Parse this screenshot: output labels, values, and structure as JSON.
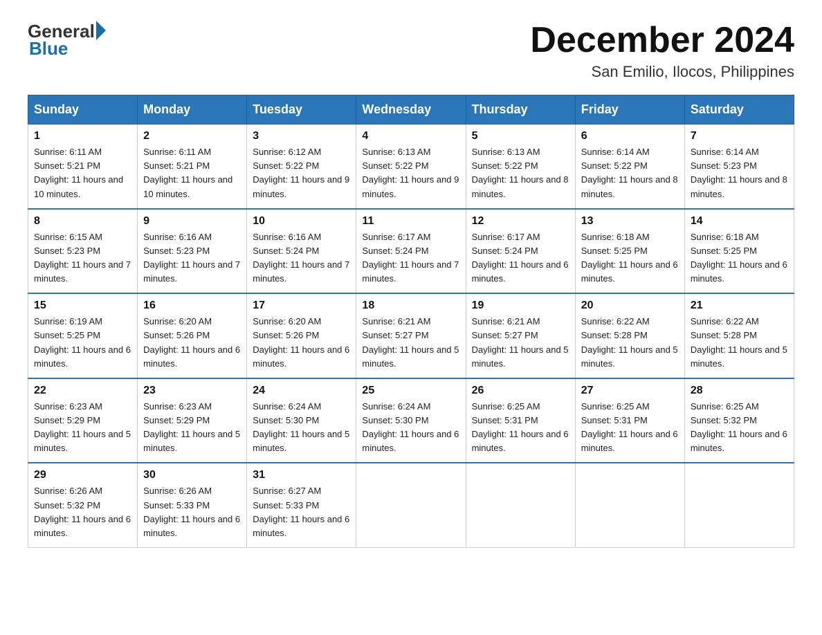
{
  "header": {
    "logo_general": "General",
    "logo_blue": "Blue",
    "month_title": "December 2024",
    "location": "San Emilio, Ilocos, Philippines"
  },
  "days_of_week": [
    "Sunday",
    "Monday",
    "Tuesday",
    "Wednesday",
    "Thursday",
    "Friday",
    "Saturday"
  ],
  "weeks": [
    [
      {
        "day": "1",
        "sunrise": "6:11 AM",
        "sunset": "5:21 PM",
        "daylight": "11 hours and 10 minutes."
      },
      {
        "day": "2",
        "sunrise": "6:11 AM",
        "sunset": "5:21 PM",
        "daylight": "11 hours and 10 minutes."
      },
      {
        "day": "3",
        "sunrise": "6:12 AM",
        "sunset": "5:22 PM",
        "daylight": "11 hours and 9 minutes."
      },
      {
        "day": "4",
        "sunrise": "6:13 AM",
        "sunset": "5:22 PM",
        "daylight": "11 hours and 9 minutes."
      },
      {
        "day": "5",
        "sunrise": "6:13 AM",
        "sunset": "5:22 PM",
        "daylight": "11 hours and 8 minutes."
      },
      {
        "day": "6",
        "sunrise": "6:14 AM",
        "sunset": "5:22 PM",
        "daylight": "11 hours and 8 minutes."
      },
      {
        "day": "7",
        "sunrise": "6:14 AM",
        "sunset": "5:23 PM",
        "daylight": "11 hours and 8 minutes."
      }
    ],
    [
      {
        "day": "8",
        "sunrise": "6:15 AM",
        "sunset": "5:23 PM",
        "daylight": "11 hours and 7 minutes."
      },
      {
        "day": "9",
        "sunrise": "6:16 AM",
        "sunset": "5:23 PM",
        "daylight": "11 hours and 7 minutes."
      },
      {
        "day": "10",
        "sunrise": "6:16 AM",
        "sunset": "5:24 PM",
        "daylight": "11 hours and 7 minutes."
      },
      {
        "day": "11",
        "sunrise": "6:17 AM",
        "sunset": "5:24 PM",
        "daylight": "11 hours and 7 minutes."
      },
      {
        "day": "12",
        "sunrise": "6:17 AM",
        "sunset": "5:24 PM",
        "daylight": "11 hours and 6 minutes."
      },
      {
        "day": "13",
        "sunrise": "6:18 AM",
        "sunset": "5:25 PM",
        "daylight": "11 hours and 6 minutes."
      },
      {
        "day": "14",
        "sunrise": "6:18 AM",
        "sunset": "5:25 PM",
        "daylight": "11 hours and 6 minutes."
      }
    ],
    [
      {
        "day": "15",
        "sunrise": "6:19 AM",
        "sunset": "5:25 PM",
        "daylight": "11 hours and 6 minutes."
      },
      {
        "day": "16",
        "sunrise": "6:20 AM",
        "sunset": "5:26 PM",
        "daylight": "11 hours and 6 minutes."
      },
      {
        "day": "17",
        "sunrise": "6:20 AM",
        "sunset": "5:26 PM",
        "daylight": "11 hours and 6 minutes."
      },
      {
        "day": "18",
        "sunrise": "6:21 AM",
        "sunset": "5:27 PM",
        "daylight": "11 hours and 5 minutes."
      },
      {
        "day": "19",
        "sunrise": "6:21 AM",
        "sunset": "5:27 PM",
        "daylight": "11 hours and 5 minutes."
      },
      {
        "day": "20",
        "sunrise": "6:22 AM",
        "sunset": "5:28 PM",
        "daylight": "11 hours and 5 minutes."
      },
      {
        "day": "21",
        "sunrise": "6:22 AM",
        "sunset": "5:28 PM",
        "daylight": "11 hours and 5 minutes."
      }
    ],
    [
      {
        "day": "22",
        "sunrise": "6:23 AM",
        "sunset": "5:29 PM",
        "daylight": "11 hours and 5 minutes."
      },
      {
        "day": "23",
        "sunrise": "6:23 AM",
        "sunset": "5:29 PM",
        "daylight": "11 hours and 5 minutes."
      },
      {
        "day": "24",
        "sunrise": "6:24 AM",
        "sunset": "5:30 PM",
        "daylight": "11 hours and 5 minutes."
      },
      {
        "day": "25",
        "sunrise": "6:24 AM",
        "sunset": "5:30 PM",
        "daylight": "11 hours and 6 minutes."
      },
      {
        "day": "26",
        "sunrise": "6:25 AM",
        "sunset": "5:31 PM",
        "daylight": "11 hours and 6 minutes."
      },
      {
        "day": "27",
        "sunrise": "6:25 AM",
        "sunset": "5:31 PM",
        "daylight": "11 hours and 6 minutes."
      },
      {
        "day": "28",
        "sunrise": "6:25 AM",
        "sunset": "5:32 PM",
        "daylight": "11 hours and 6 minutes."
      }
    ],
    [
      {
        "day": "29",
        "sunrise": "6:26 AM",
        "sunset": "5:32 PM",
        "daylight": "11 hours and 6 minutes."
      },
      {
        "day": "30",
        "sunrise": "6:26 AM",
        "sunset": "5:33 PM",
        "daylight": "11 hours and 6 minutes."
      },
      {
        "day": "31",
        "sunrise": "6:27 AM",
        "sunset": "5:33 PM",
        "daylight": "11 hours and 6 minutes."
      },
      null,
      null,
      null,
      null
    ]
  ],
  "labels": {
    "sunrise": "Sunrise:",
    "sunset": "Sunset:",
    "daylight": "Daylight:"
  }
}
